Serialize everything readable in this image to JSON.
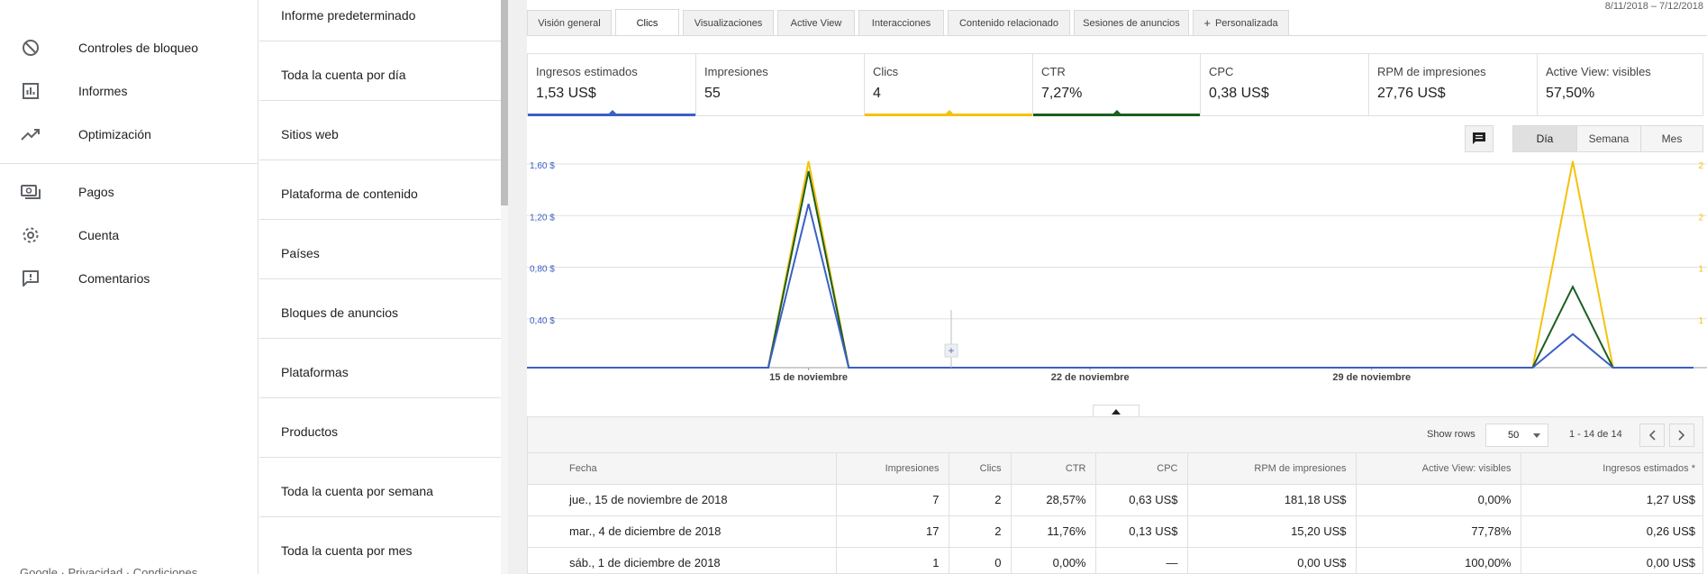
{
  "nav": {
    "items": [
      {
        "label": "Controles de bloqueo",
        "icon": "block-icon"
      },
      {
        "label": "Informes",
        "icon": "bar-chart-icon"
      },
      {
        "label": "Optimización",
        "icon": "trending-up-icon"
      },
      {
        "label": "Pagos",
        "icon": "payments-icon"
      },
      {
        "label": "Cuenta",
        "icon": "gear-icon"
      },
      {
        "label": "Comentarios",
        "icon": "feedback-icon"
      }
    ],
    "footer": "Google · Privacidad · Condiciones"
  },
  "reports": {
    "items": [
      "Informe predeterminado",
      "Toda la cuenta por día",
      "Sitios web",
      "Plataforma de contenido",
      "Países",
      "Bloques de anuncios",
      "Plataformas",
      "Productos",
      "Toda la cuenta por semana",
      "Toda la cuenta por mes"
    ]
  },
  "tabs": {
    "items": [
      "Visión general",
      "Clics",
      "Visualizaciones",
      "Active View",
      "Interacciones",
      "Contenido relacionado",
      "Sesiones de anuncios",
      "Personalizada"
    ],
    "active": "Clics"
  },
  "date_range": "8/11/2018 – 7/12/2018",
  "metrics": {
    "items": [
      {
        "name": "Ingresos estimados",
        "value": "1,53 US$",
        "color": "#3b5fc5"
      },
      {
        "name": "Impresiones",
        "value": "55",
        "color": ""
      },
      {
        "name": "Clics",
        "value": "4",
        "color": "#f4c20d"
      },
      {
        "name": "CTR",
        "value": "7,27%",
        "color": "#1b5e20"
      },
      {
        "name": "CPC",
        "value": "0,38 US$",
        "color": ""
      },
      {
        "name": "RPM de impresiones",
        "value": "27,76 US$",
        "color": ""
      },
      {
        "name": "Active View: visibles",
        "value": "57,50%",
        "color": ""
      }
    ]
  },
  "chart_controls": {
    "periods": [
      "Día",
      "Semana",
      "Mes"
    ],
    "active": "Día"
  },
  "chart_data": {
    "type": "line",
    "x": [
      "8/11",
      "9/11",
      "10/11",
      "11/11",
      "12/11",
      "13/11",
      "14/11",
      "15/11",
      "16/11",
      "17/11",
      "18/11",
      "19/11",
      "20/11",
      "21/11",
      "22/11",
      "23/11",
      "24/11",
      "25/11",
      "26/11",
      "27/11",
      "28/11",
      "29/11",
      "30/11",
      "1/12",
      "2/12",
      "3/12",
      "4/12",
      "5/12",
      "6/12",
      "7/12"
    ],
    "x_tick_labels": [
      "15 de noviembre",
      "22 de noviembre",
      "29 de noviembre"
    ],
    "y_left_ticks": [
      "0,40 $",
      "0,80 $",
      "1,20 $",
      "1,60 $"
    ],
    "y_right_ticks": [
      "1",
      "1",
      "2",
      "2"
    ],
    "series": [
      {
        "name": "Ingresos estimados",
        "color": "#3b5fc5",
        "axis": "left",
        "values": [
          0,
          0,
          0,
          0,
          0,
          0,
          0,
          1.27,
          0,
          0,
          0,
          0,
          0,
          0,
          0,
          0,
          0,
          0,
          0,
          0,
          0,
          0,
          0,
          0,
          0,
          0,
          0.26,
          0,
          0,
          0
        ]
      },
      {
        "name": "Clics",
        "color": "#f4c20d",
        "axis": "right",
        "values": [
          0,
          0,
          0,
          0,
          0,
          0,
          0,
          2,
          0,
          0,
          0,
          0,
          0,
          0,
          0,
          0,
          0,
          0,
          0,
          0,
          0,
          0,
          0,
          0,
          0,
          0,
          2,
          0,
          0,
          0
        ]
      },
      {
        "name": "CTR",
        "color": "#1b5e20",
        "axis": "ctr",
        "values": [
          0,
          0,
          0,
          0,
          0,
          0,
          0,
          28.57,
          0,
          0,
          0,
          0,
          0,
          0,
          0,
          0,
          0,
          0,
          0,
          0,
          0,
          0,
          0,
          0,
          0,
          0,
          11.76,
          0,
          0,
          0
        ]
      }
    ],
    "y_left_range": [
      0,
      1.6
    ],
    "y_right_range": [
      0,
      2
    ],
    "y_ctr_range": [
      0,
      30
    ],
    "grid": true
  },
  "table": {
    "show_rows_label": "Show rows",
    "rows_value": "50",
    "pager": "1 - 14 de 14",
    "columns": [
      "Fecha",
      "Impresiones",
      "Clics",
      "CTR",
      "CPC",
      "RPM de impresiones",
      "Active View: visibles",
      "Ingresos estimados *"
    ],
    "rows": [
      [
        "jue., 15 de noviembre de 2018",
        "7",
        "2",
        "28,57%",
        "0,63 US$",
        "181,18 US$",
        "0,00%",
        "1,27 US$"
      ],
      [
        "mar., 4 de diciembre de 2018",
        "17",
        "2",
        "11,76%",
        "0,13 US$",
        "15,20 US$",
        "77,78%",
        "0,26 US$"
      ],
      [
        "sáb., 1 de diciembre de 2018",
        "1",
        "0",
        "0,00%",
        "—",
        "0,00 US$",
        "100,00%",
        "0,00 US$"
      ]
    ]
  }
}
